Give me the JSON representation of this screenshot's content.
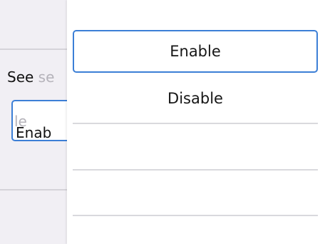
{
  "background_screen": {
    "row_label_visible": "See ",
    "row_label_faded": "se",
    "field_value_visible": "Enab",
    "field_value_faded": "le"
  },
  "dropdown": {
    "options": [
      {
        "label": "Enable",
        "selected": true
      },
      {
        "label": "Disable",
        "selected": false
      }
    ]
  },
  "colors": {
    "accent": "#3c7fd6",
    "background_screen": "#f1eff4",
    "divider": "#d9d9dd",
    "text": "#161616"
  }
}
